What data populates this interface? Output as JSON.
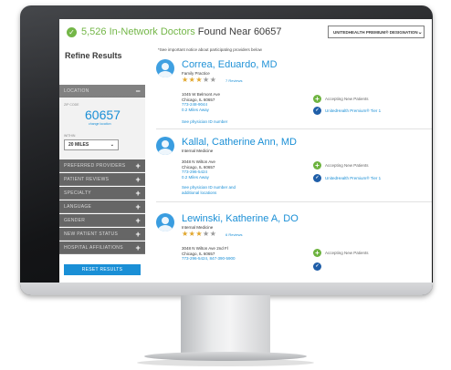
{
  "header": {
    "count": "5,526",
    "title_rest": "In-Network Doctors",
    "title_found": "Found Near 60657",
    "designation_select": "UNITEDHEALTH PREMIUM® DESIGNATION"
  },
  "notice": "*See important notice about participating providers below",
  "sidebar": {
    "title": "Refine Results",
    "location_label": "LOCATION",
    "zip_label": "ZIP CODE",
    "zip_value": "60657",
    "change_location": "change location",
    "within_label": "WITHIN",
    "within_value": "20 MILES",
    "sections": [
      "PREFERRED PROVIDERS",
      "PATIENT REVIEWS",
      "SPECIALTY",
      "LANGUAGE",
      "GENDER",
      "NEW PATIENT STATUS",
      "HOSPITAL AFFILIATIONS"
    ],
    "reset_label": "RESET RESULTS"
  },
  "doctors": [
    {
      "name": "Correa, Eduardo, MD",
      "specialty": "Family Practice",
      "rating": 3,
      "reviews": "7 Reviews",
      "address1": "1045 W Belmont Ave",
      "address2": "Chicago, IL 60657",
      "phone": "773-248-9044",
      "distance": "0.2 Miles Away",
      "info_link": "See physician ID number",
      "info_link2": "",
      "accepting": "Accepting New Patients",
      "premium": "UnitedHealth Premium® Tier 1"
    },
    {
      "name": "Kallal, Catherine Ann, MD",
      "specialty": "Internal Medicine",
      "rating": 0,
      "reviews": "",
      "address1": "3048 N Wilton Ave",
      "address2": "Chicago, IL 60657",
      "phone": "773-296-5424",
      "distance": "0.2 Miles Away",
      "info_link": "See physician ID number and",
      "info_link2": "additional locations",
      "accepting": "Accepting New Patients",
      "premium": "UnitedHealth Premium® Tier 1"
    },
    {
      "name": "Lewinski, Katherine A, DO",
      "specialty": "Internal Medicine",
      "rating": 3,
      "reviews": "6 Reviews",
      "address1": "3048 N Wilton Ave 2nd Fl",
      "address2": "Chicago, IL 60657",
      "phone": "773-296-5424, 847-390-5900",
      "distance": "",
      "info_link": "",
      "info_link2": "",
      "accepting": "Accepting New Patients",
      "premium": ""
    }
  ],
  "colors": {
    "green": "#6db33f",
    "link_blue": "#1a8fd6",
    "sidebar_gray": "#666666",
    "star_gold": "#e1a62b"
  }
}
